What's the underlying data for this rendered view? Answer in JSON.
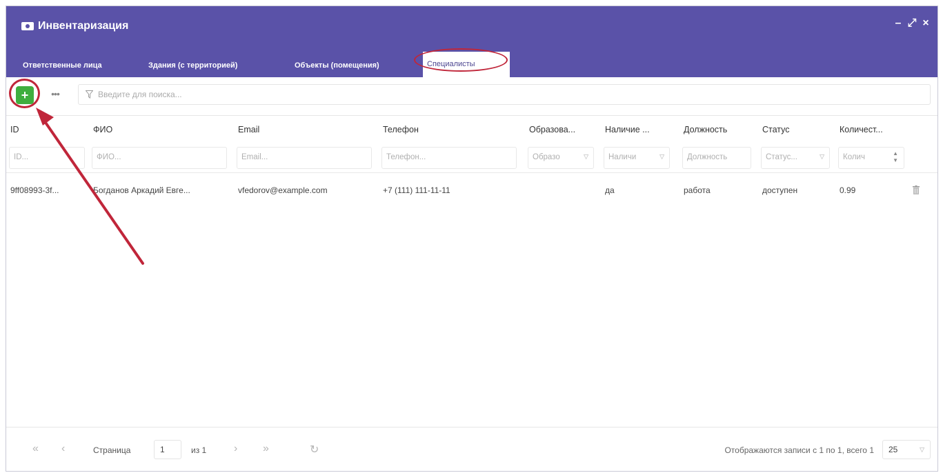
{
  "window": {
    "title": "Инвентаризация"
  },
  "tabs": [
    {
      "label": "Ответственные лица"
    },
    {
      "label": "Здания (с территорией)"
    },
    {
      "label": "Объекты (помещения)"
    },
    {
      "label": "Специалисты"
    }
  ],
  "toolbar": {
    "add_label": "+",
    "more_label": "•••",
    "search_placeholder": "Введите для поиска..."
  },
  "columns": [
    {
      "label": "ID",
      "filter_placeholder": "ID..."
    },
    {
      "label": "ФИО",
      "filter_placeholder": "ФИО..."
    },
    {
      "label": "Email",
      "filter_placeholder": "Email..."
    },
    {
      "label": "Телефон",
      "filter_placeholder": "Телефон..."
    },
    {
      "label": "Образова...",
      "filter_placeholder": "Образо"
    },
    {
      "label": "Наличие ...",
      "filter_placeholder": "Наличи"
    },
    {
      "label": "Должность",
      "filter_placeholder": "Должность"
    },
    {
      "label": "Статус",
      "filter_placeholder": "Статус..."
    },
    {
      "label": "Количест...",
      "filter_placeholder": "Колич"
    }
  ],
  "rows": [
    {
      "id": "9ff08993-3f...",
      "fio": "Богданов Аркадий Евге...",
      "email": "vfedorov@example.com",
      "phone": "+7 (111) 111-11-11",
      "education": "",
      "presence": "да",
      "position": "работа",
      "status": "доступен",
      "quantity": "0.99"
    }
  ],
  "pagination": {
    "page_label": "Страница",
    "page_value": "1",
    "of_label": "из 1",
    "info": "Отображаются записи с 1 по 1, всего 1",
    "page_size": "25"
  },
  "colors": {
    "header": "#5a52a8",
    "add_button": "#3fae3f",
    "annotation": "#c0263a"
  }
}
